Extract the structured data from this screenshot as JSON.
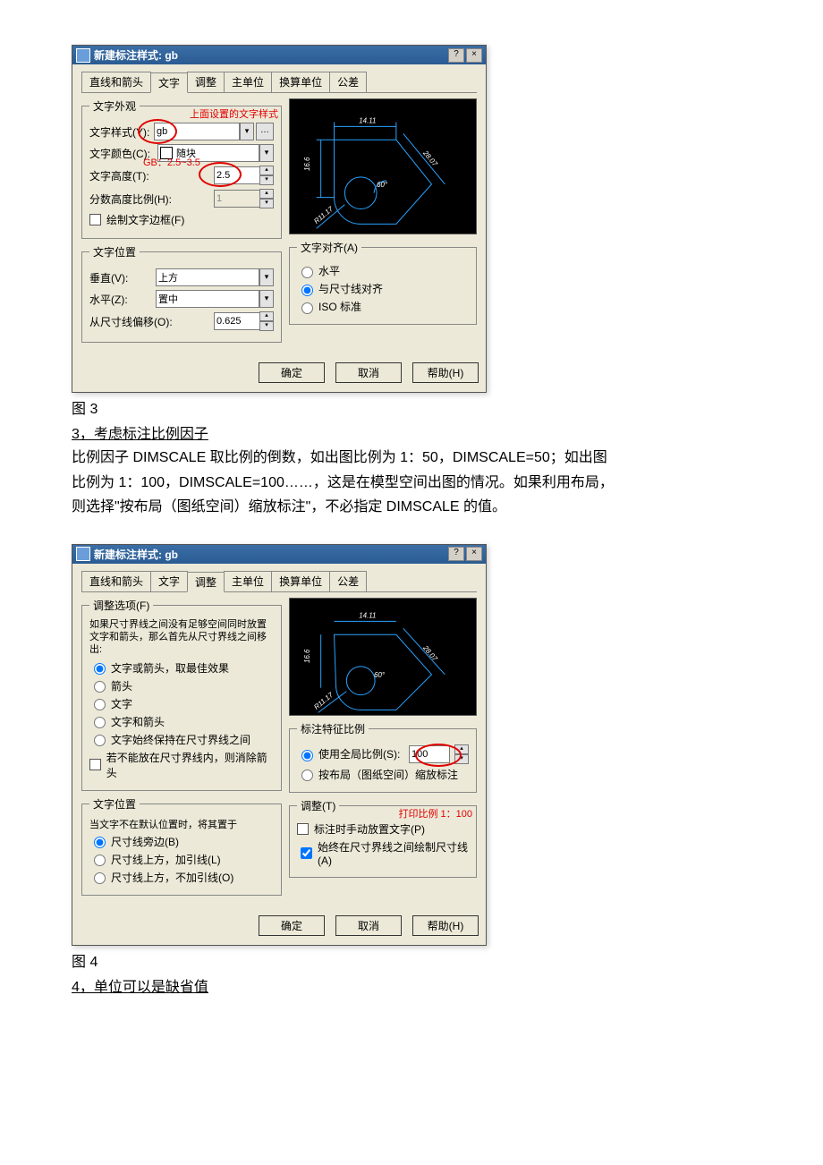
{
  "dialog1": {
    "title": "新建标注样式: gb",
    "tabs": [
      "直线和箭头",
      "文字",
      "调整",
      "主单位",
      "换算单位",
      "公差"
    ],
    "active_tab": "文字",
    "appearance": {
      "legend": "文字外观",
      "note_above": "上面设置的文字样式",
      "style_label": "文字样式(Y):",
      "style_value": "gb",
      "color_label": "文字颜色(C):",
      "color_value": "随块",
      "gb_note": "GB：2.5~3.5",
      "height_label": "文字高度(T):",
      "height_value": "2.5",
      "frac_label": "分数高度比例(H):",
      "frac_value": "1",
      "frame_label": "绘制文字边框(F)"
    },
    "position": {
      "legend": "文字位置",
      "v_label": "垂直(V):",
      "v_value": "上方",
      "h_label": "水平(Z):",
      "h_value": "置中",
      "offset_label": "从尺寸线偏移(O):",
      "offset_value": "0.625"
    },
    "align": {
      "legend": "文字对齐(A)",
      "opt1": "水平",
      "opt2": "与尺寸线对齐",
      "opt3": "ISO 标准"
    },
    "preview_dims": {
      "top": "14.11",
      "left": "16.6",
      "diag": "28.07",
      "angle": "60°",
      "rad": "R11.17"
    },
    "buttons": {
      "ok": "确定",
      "cancel": "取消",
      "help": "帮助(H)"
    }
  },
  "fig3": "图 3",
  "sec3_title": "3，考虑标注比例因子",
  "para3a": "比例因子 DIMSCALE 取比例的倒数，如出图比例为 1：50，DIMSCALE=50；如出图",
  "para3b": "比例为 1：100，DIMSCALE=100……，这是在模型空间出图的情况。如果利用布局，",
  "para3c": "则选择\"按布局（图纸空间）缩放标注\"，不必指定 DIMSCALE 的值。",
  "dialog2": {
    "title": "新建标注样式: gb",
    "tabs": [
      "直线和箭头",
      "文字",
      "调整",
      "主单位",
      "换算单位",
      "公差"
    ],
    "active_tab": "调整",
    "fit_options": {
      "legend": "调整选项(F)",
      "intro": "如果尺寸界线之间没有足够空间同时放置文字和箭头，那么首先从尺寸界线之间移出:",
      "r1": "文字或箭头，取最佳效果",
      "r2": "箭头",
      "r3": "文字",
      "r4": "文字和箭头",
      "r5": "文字始终保持在尺寸界线之间",
      "c1": "若不能放在尺寸界线内，则消除箭头"
    },
    "text_place": {
      "legend": "文字位置",
      "intro": "当文字不在默认位置时，将其置于",
      "r1": "尺寸线旁边(B)",
      "r2": "尺寸线上方，加引线(L)",
      "r3": "尺寸线上方，不加引线(O)"
    },
    "scale": {
      "legend": "标注特征比例",
      "r1": "使用全局比例(S):",
      "value": "100",
      "r2": "按布局（图纸空间）缩放标注"
    },
    "adjust": {
      "legend": "调整(T)",
      "rednote": "打印比例 1：100",
      "c1": "标注时手动放置文字(P)",
      "c2": "始终在尺寸界线之间绘制尺寸线(A)"
    },
    "preview_dims": {
      "top": "14.11",
      "left": "16.6",
      "diag": "28.07",
      "angle": "60°",
      "rad": "R11.17"
    },
    "buttons": {
      "ok": "确定",
      "cancel": "取消",
      "help": "帮助(H)"
    }
  },
  "fig4": "图 4",
  "sec4_title": "4，单位可以是缺省值"
}
